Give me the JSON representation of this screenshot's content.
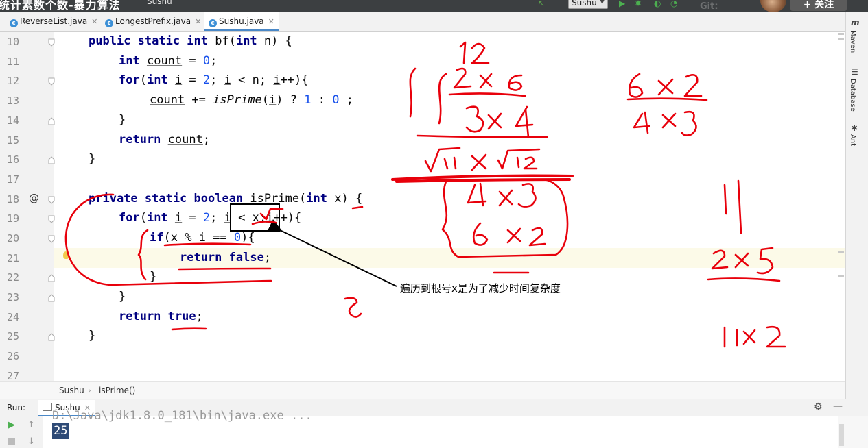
{
  "window": {
    "video_title": "统计素数个数-暴力算法",
    "project_name": "Sushu",
    "run_config": "Sushu",
    "follow_button": "+ 关注"
  },
  "tabs": [
    {
      "label": "ReverseList.java",
      "active": false
    },
    {
      "label": "LongestPrefix.java",
      "active": false
    },
    {
      "label": "Sushu.java",
      "active": true
    }
  ],
  "right_tools": [
    "Maven",
    "Database",
    "Ant"
  ],
  "editor": {
    "line_numbers": [
      "10",
      "11",
      "12",
      "13",
      "14",
      "15",
      "16",
      "17",
      "18",
      "19",
      "20",
      "21",
      "22",
      "23",
      "24",
      "25",
      "26",
      "27"
    ],
    "current_line": "21"
  },
  "breadcrumb": {
    "class": "Sushu",
    "method": "isPrime()"
  },
  "run_panel": {
    "label": "Run:",
    "tab": "Sushu",
    "command_line": "D:\\Java\\jdk1.8.0_181\\bin\\java.exe ...",
    "output": "25"
  },
  "annotation": {
    "text": "遍历到根号x是为了减少时间复杂度"
  },
  "colors": {
    "keyword": "#000080",
    "number": "#1750eb",
    "ink": "#e8000b",
    "caret_row": "#fcfae8"
  }
}
